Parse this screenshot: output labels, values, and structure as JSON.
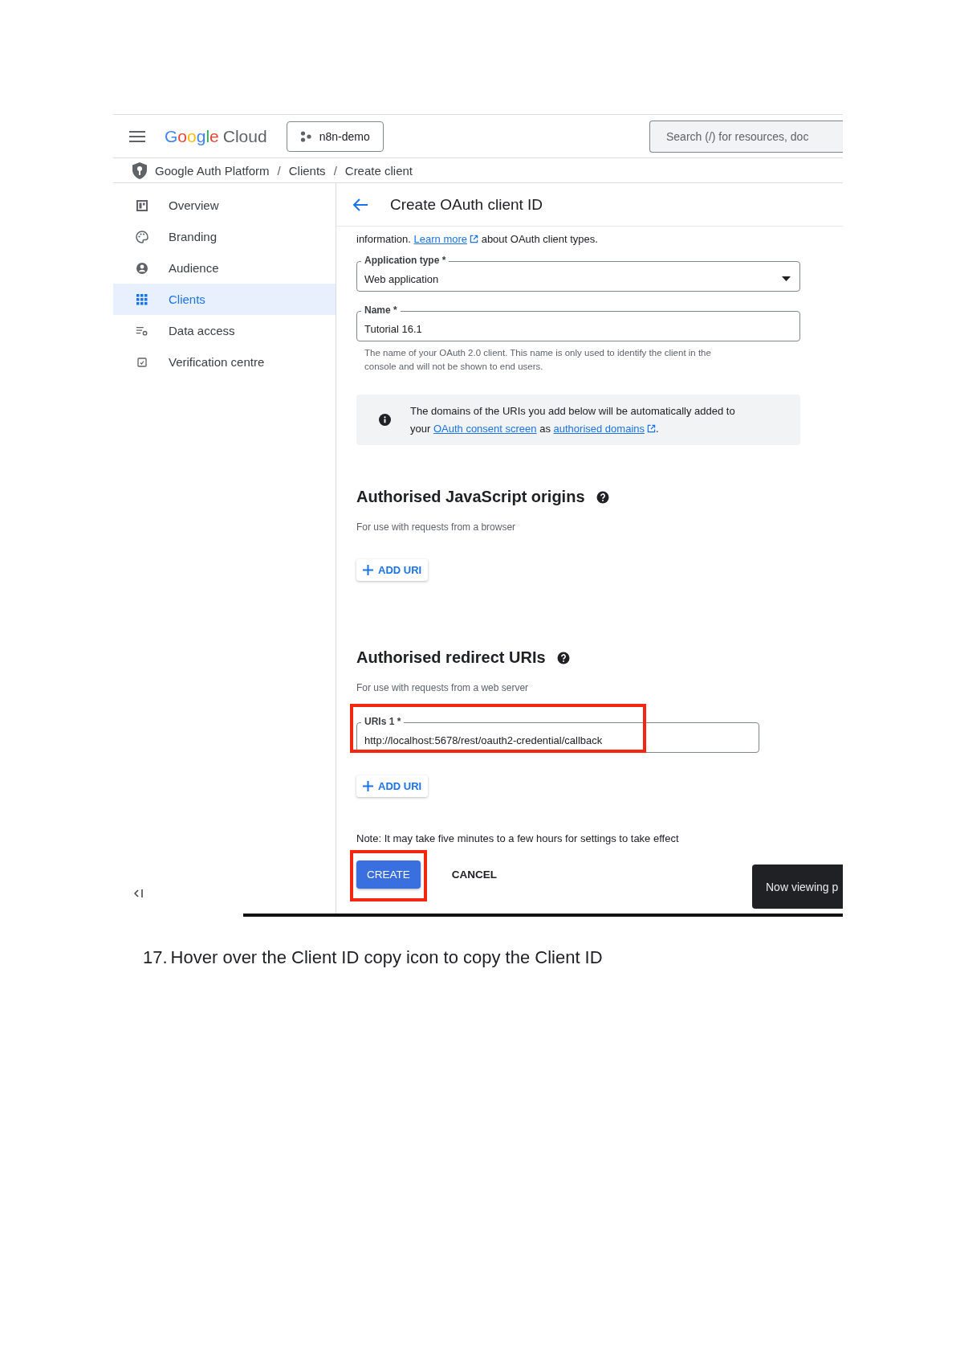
{
  "topbar": {
    "logo_word": "Google",
    "logo_product": "Cloud",
    "project": "n8n-demo",
    "search": {
      "placeholder": "Search (/) for resources, doc"
    }
  },
  "breadcrumb": [
    {
      "kind": "link",
      "text": "Google Auth Platform"
    },
    {
      "kind": "separator",
      "text": "/"
    },
    {
      "kind": "link",
      "text": "Clients"
    },
    {
      "kind": "separator",
      "text": "/"
    },
    {
      "kind": "link",
      "text": "Create client"
    }
  ],
  "sidebar": {
    "items": [
      {
        "label": "Overview",
        "selected": false
      },
      {
        "label": "Branding",
        "selected": false
      },
      {
        "label": "Audience",
        "selected": false
      },
      {
        "label": "Clients",
        "selected": true
      },
      {
        "label": "Data access",
        "selected": false
      },
      {
        "label": "Verification centre",
        "selected": false
      }
    ]
  },
  "page": {
    "title": "Create OAuth client ID",
    "intro": {
      "before": "information.",
      "link": "Learn more",
      "after": "about OAuth client types."
    },
    "application_type": {
      "label": "Application type *",
      "value": "Web application"
    },
    "name": {
      "label": "Name *",
      "value": "Tutorial 16.1",
      "help": "The name of your OAuth 2.0 client. This name is only used to identify the client in the console and will not be shown to end users."
    },
    "info": {
      "before": "The domains of the URIs you add below will be automatically added to your",
      "link_1": "OAuth consent screen",
      "middle": "as",
      "link_2": "authorised domains",
      "end": "."
    },
    "sections": [
      {
        "heading": "Authorised JavaScript origins",
        "subtext": "For use with requests from a browser",
        "add_button": "ADD URI"
      },
      {
        "heading": "Authorised redirect URIs",
        "subtext": "For use with requests from a web server",
        "uris": [
          {
            "label": "URIs 1 *",
            "value": "http://localhost:5678/rest/oauth2-credential/callback",
            "highlighted": true
          }
        ],
        "add_button": "ADD URI"
      }
    ],
    "note": "Note: It may take five minutes to a few hours for settings to take effect",
    "buttons": [
      {
        "label": "CREATE",
        "kind": "primary",
        "highlighted": true
      },
      {
        "label": "CANCEL",
        "kind": "text",
        "highlighted": false
      }
    ],
    "toast": "Now viewing p"
  },
  "step": {
    "number": "17.",
    "text": "Hover over the Client ID copy icon to copy the Client ID"
  }
}
